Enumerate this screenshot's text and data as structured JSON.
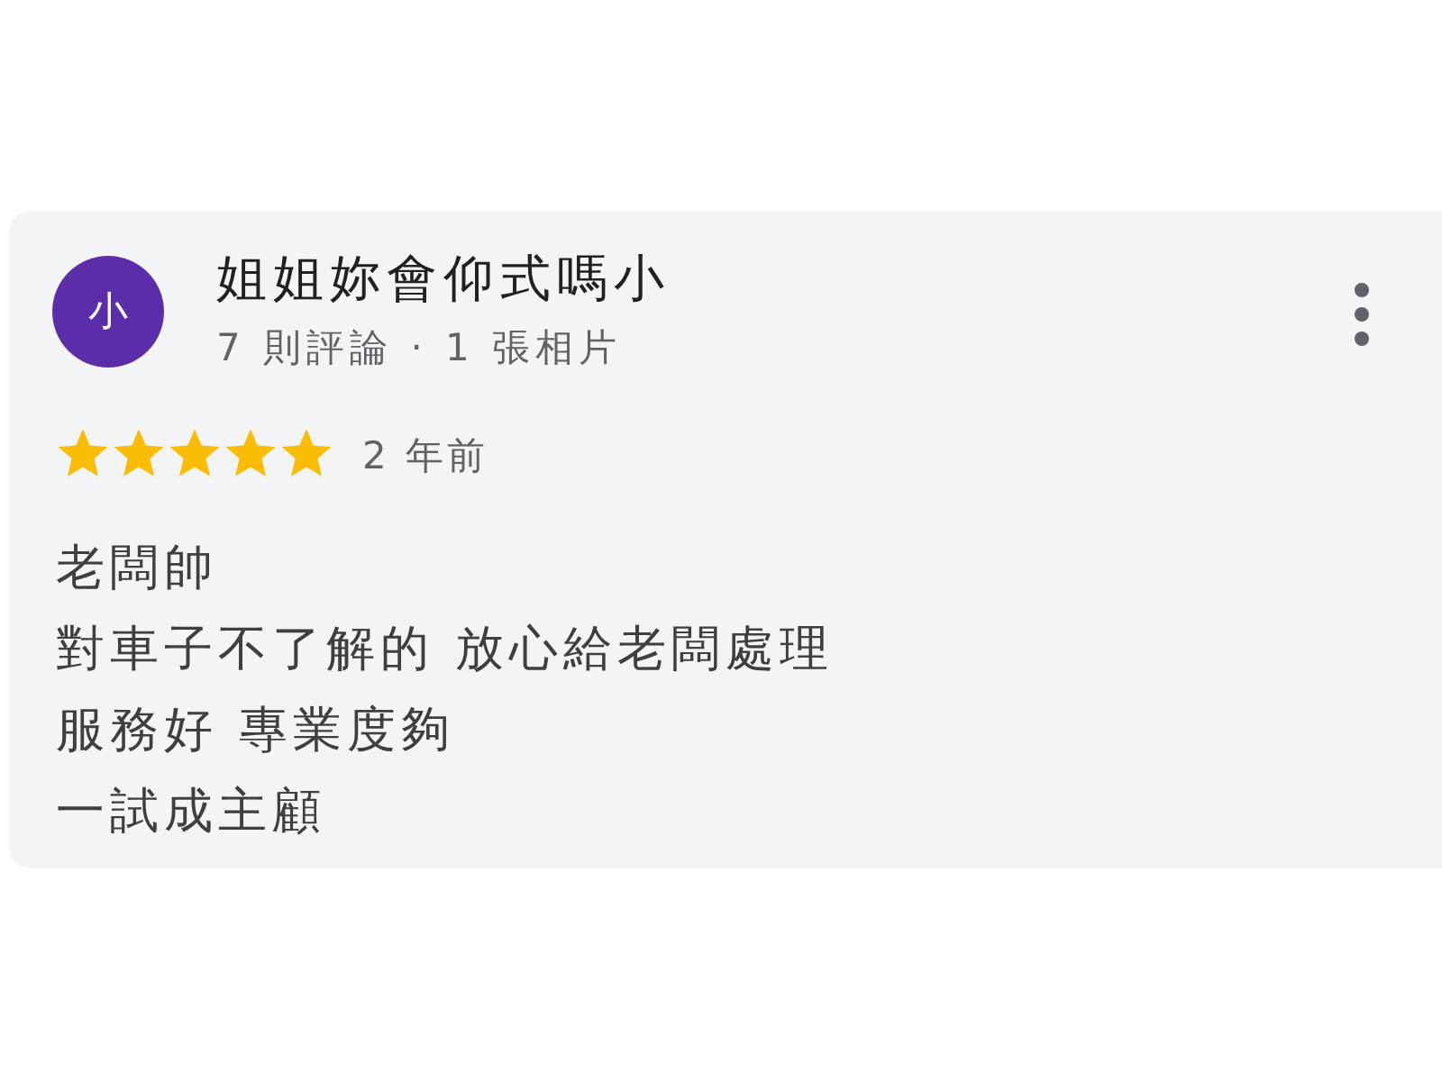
{
  "review": {
    "author": {
      "avatar_letter": "小",
      "name": "姐姐妳會仰式嗎小",
      "meta": "7 則評論 · 1 張相片"
    },
    "stars": 5,
    "time": "2 年前",
    "text_lines": [
      "老闆帥",
      "對車子不了解的 放心給老闆處理",
      "服務好 專業度夠",
      "一試成主顧"
    ]
  }
}
